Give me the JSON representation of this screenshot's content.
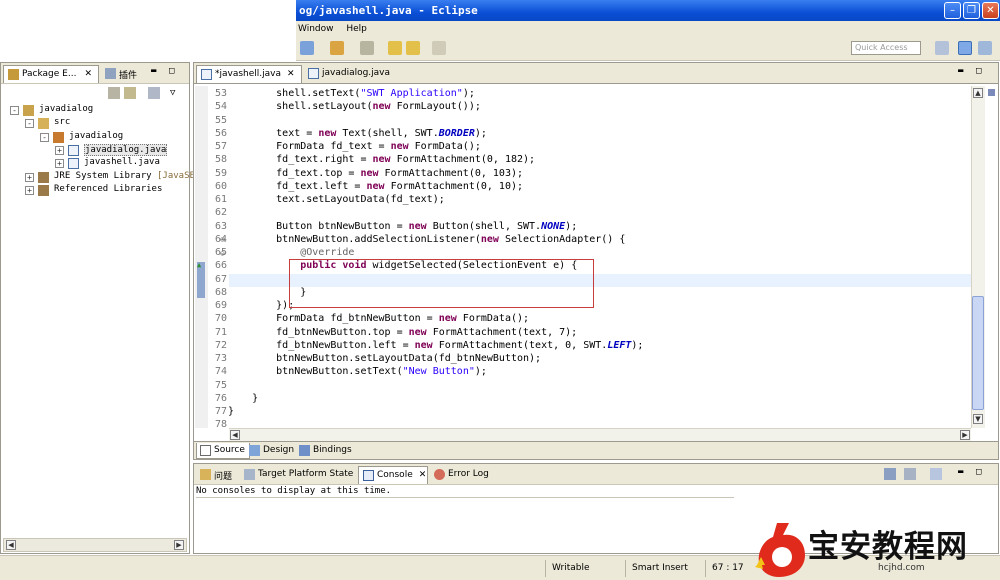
{
  "window": {
    "title": "og/javashell.java - Eclipse",
    "controls": [
      "minimize",
      "maximize",
      "close"
    ]
  },
  "menu": [
    "Window",
    "Help"
  ],
  "quick_access": {
    "placeholder": "Quick Access"
  },
  "package_explorer": {
    "tabs": [
      {
        "label": "Package E...",
        "icon": "package-icon"
      },
      {
        "label": "插件",
        "icon": "plugin-icon"
      }
    ],
    "tree": [
      {
        "label": "javadialog",
        "icon": "project-icon",
        "depth": 0,
        "expander": "-"
      },
      {
        "label": "src",
        "icon": "source-folder-icon",
        "depth": 1,
        "expander": "-"
      },
      {
        "label": "javadialog",
        "icon": "package-icon",
        "depth": 2,
        "expander": "-"
      },
      {
        "label": "javadialog.java",
        "icon": "java-file-icon",
        "depth": 3,
        "expander": "+",
        "selected": true
      },
      {
        "label": "javashell.java",
        "icon": "java-file-icon",
        "depth": 3,
        "expander": "+"
      },
      {
        "label": "JRE System Library",
        "suffix": "[JavaSE-1.",
        "icon": "library-icon",
        "depth": 1,
        "expander": "+"
      },
      {
        "label": "Referenced Libraries",
        "icon": "library-icon",
        "depth": 1,
        "expander": "+"
      }
    ]
  },
  "editor": {
    "tabs": [
      {
        "label": "*javashell.java",
        "active": true
      },
      {
        "label": "javadialog.java",
        "active": false
      }
    ],
    "lines": [
      {
        "n": "53",
        "code": "        shell.setText(\"SWT Application\");"
      },
      {
        "n": "54",
        "code": "        shell.setLayout(new FormLayout());"
      },
      {
        "n": "55",
        "code": ""
      },
      {
        "n": "56",
        "code": "        text = new Text(shell, SWT.BORDER);"
      },
      {
        "n": "57",
        "code": "        FormData fd_text = new FormData();"
      },
      {
        "n": "58",
        "code": "        fd_text.right = new FormAttachment(0, 182);"
      },
      {
        "n": "59",
        "code": "        fd_text.top = new FormAttachment(0, 103);"
      },
      {
        "n": "60",
        "code": "        fd_text.left = new FormAttachment(0, 10);"
      },
      {
        "n": "61",
        "code": "        text.setLayoutData(fd_text);"
      },
      {
        "n": "62",
        "code": ""
      },
      {
        "n": "63",
        "code": "        Button btnNewButton = new Button(shell, SWT.NONE);"
      },
      {
        "n": "64",
        "code": "        btnNewButton.addSelectionListener(new SelectionAdapter() {"
      },
      {
        "n": "65",
        "code": "            @Override"
      },
      {
        "n": "66",
        "code": "            public void widgetSelected(SelectionEvent e) {"
      },
      {
        "n": "67",
        "code": ""
      },
      {
        "n": "68",
        "code": "            }"
      },
      {
        "n": "69",
        "code": "        });"
      },
      {
        "n": "70",
        "code": "        FormData fd_btnNewButton = new FormData();"
      },
      {
        "n": "71",
        "code": "        fd_btnNewButton.top = new FormAttachment(text, 7);"
      },
      {
        "n": "72",
        "code": "        fd_btnNewButton.left = new FormAttachment(text, 0, SWT.LEFT);"
      },
      {
        "n": "73",
        "code": "        btnNewButton.setLayoutData(fd_btnNewButton);"
      },
      {
        "n": "74",
        "code": "        btnNewButton.setText(\"New Button\");"
      },
      {
        "n": "75",
        "code": ""
      },
      {
        "n": "76",
        "code": "    }"
      },
      {
        "n": "77",
        "code": "}"
      },
      {
        "n": "78",
        "code": ""
      }
    ],
    "bottom_tabs": [
      {
        "label": "Source",
        "active": true
      },
      {
        "label": "Design",
        "active": false
      },
      {
        "label": "Bindings",
        "active": false
      }
    ]
  },
  "console_panel": {
    "tabs": [
      {
        "label": "问题",
        "active": false
      },
      {
        "label": "Target Platform State",
        "active": false
      },
      {
        "label": "Console",
        "active": true
      },
      {
        "label": "Error Log",
        "active": false
      }
    ],
    "message": "No consoles to display at this time."
  },
  "status_bar": {
    "mode": "Writable",
    "insert": "Smart Insert",
    "position": "67 : 17"
  },
  "watermark": {
    "text": "宝安教程网",
    "url": "hcjhd.com"
  },
  "colors": {
    "titlebar": "#0a4fd6",
    "chrome": "#ece9d8",
    "keyword": "#7f0055",
    "string": "#2a00ff",
    "annotation": "#646464",
    "current_line": "#e8f2fe",
    "highlight_box": "#c83c3c"
  }
}
